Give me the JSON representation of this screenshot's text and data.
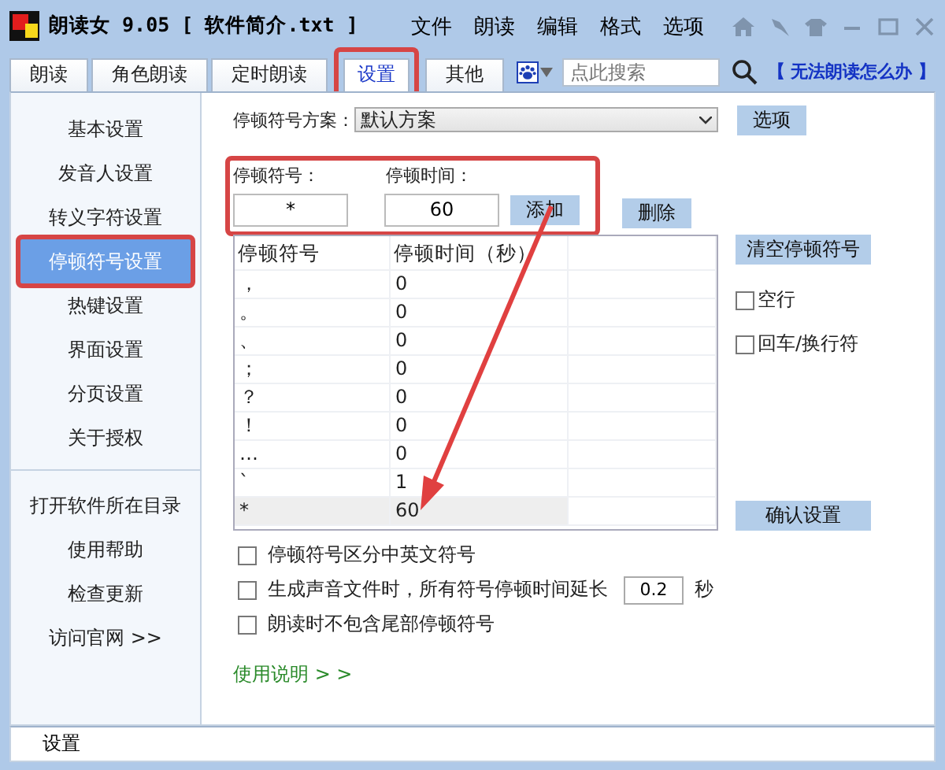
{
  "window": {
    "title": "朗读女 9.05 [ 软件简介.txt ]"
  },
  "menu": [
    "文件",
    "朗读",
    "编辑",
    "格式",
    "选项"
  ],
  "tabs": [
    {
      "label": "朗读",
      "selected": false,
      "highlighted": false
    },
    {
      "label": "角色朗读",
      "selected": false,
      "highlighted": false
    },
    {
      "label": "定时朗读",
      "selected": false,
      "highlighted": false
    },
    {
      "label": "设置",
      "selected": true,
      "highlighted": true
    },
    {
      "label": "其他",
      "selected": false,
      "highlighted": false
    }
  ],
  "search": {
    "placeholder": "点此搜索"
  },
  "help_link": "【 无法朗读怎么办 】",
  "sidebar": {
    "items": [
      {
        "label": "基本设置",
        "selected": false,
        "highlighted": false
      },
      {
        "label": "发音人设置",
        "selected": false,
        "highlighted": false
      },
      {
        "label": "转义字符设置",
        "selected": false,
        "highlighted": false
      },
      {
        "label": "停顿符号设置",
        "selected": true,
        "highlighted": true
      },
      {
        "label": "热键设置",
        "selected": false,
        "highlighted": false
      },
      {
        "label": "界面设置",
        "selected": false,
        "highlighted": false
      },
      {
        "label": "分页设置",
        "selected": false,
        "highlighted": false
      },
      {
        "label": "关于授权",
        "selected": false,
        "highlighted": false
      }
    ],
    "links": [
      "打开软件所在目录",
      "使用帮助",
      "检查更新",
      "访问官网 >>"
    ]
  },
  "scheme": {
    "label": "停顿符号方案：",
    "value": "默认方案",
    "button": "选项"
  },
  "entry": {
    "highlighted": true,
    "symbol_label": "停顿符号：",
    "symbol_value": "*",
    "time_label": "停顿时间：",
    "time_value": "60",
    "add_button": "添加",
    "delete_button": "删除"
  },
  "table": {
    "columns": [
      "停顿符号",
      "停顿时间（秒）"
    ],
    "rows": [
      {
        "symbol": "，",
        "time": "0",
        "selected": false
      },
      {
        "symbol": "。",
        "time": "0",
        "selected": false
      },
      {
        "symbol": "、",
        "time": "0",
        "selected": false
      },
      {
        "symbol": "；",
        "time": "0",
        "selected": false
      },
      {
        "symbol": "？",
        "time": "0",
        "selected": false
      },
      {
        "symbol": "！",
        "time": "0",
        "selected": false
      },
      {
        "symbol": "…",
        "time": "0",
        "selected": false
      },
      {
        "symbol": "`",
        "time": "1",
        "selected": false
      },
      {
        "symbol": "*",
        "time": "60",
        "selected": true
      }
    ]
  },
  "clear_button": "清空停顿符号",
  "side_options": [
    {
      "label": "空行",
      "checked": false
    },
    {
      "label": "回车/换行符",
      "checked": false
    }
  ],
  "confirm_button": "确认设置",
  "options": [
    {
      "kind": "checkbox",
      "label": "停顿符号区分中英文符号",
      "checked": false
    },
    {
      "kind": "checkbox-field",
      "label": "生成声音文件时，所有符号停顿时间延长",
      "checked": false,
      "value": "0.2",
      "unit": "秒"
    },
    {
      "kind": "checkbox",
      "label": "朗读时不包含尾部停顿符号",
      "checked": false
    }
  ],
  "usage_link": "使用说明 > >",
  "annotation_arrow": true,
  "status_bar": "设置"
}
